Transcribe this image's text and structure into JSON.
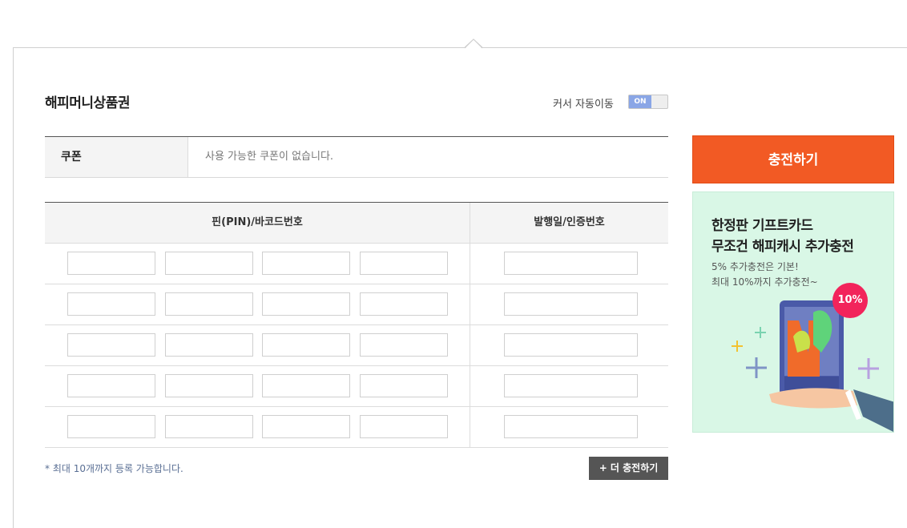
{
  "section": {
    "title": "해피머니상품권",
    "cursor_auto_move_label": "커서 자동이동",
    "toggle_state": "ON"
  },
  "coupon": {
    "label": "쿠폰",
    "value": "사용 가능한 쿠폰이 없습니다."
  },
  "table": {
    "col_pin": "핀(PIN)/바코드번호",
    "col_issue": "발행일/인증번호",
    "rows": [
      {
        "pin": [
          "",
          "",
          "",
          ""
        ],
        "issue": ""
      },
      {
        "pin": [
          "",
          "",
          "",
          ""
        ],
        "issue": ""
      },
      {
        "pin": [
          "",
          "",
          "",
          ""
        ],
        "issue": ""
      },
      {
        "pin": [
          "",
          "",
          "",
          ""
        ],
        "issue": ""
      },
      {
        "pin": [
          "",
          "",
          "",
          ""
        ],
        "issue": ""
      }
    ]
  },
  "footer": {
    "note": "* 최대 10개까지 등록 가능합니다.",
    "more_button": "+ 더 충전하기"
  },
  "sidebar": {
    "charge_button": "충전하기",
    "ad": {
      "line1": "한정판 기프트카드",
      "line2": "무조건 해피캐시 추가충전",
      "sub1": "5% 추가충전은 기본!",
      "sub2": "최대 10%까지 추가충전~",
      "badge": "10%"
    }
  },
  "colors": {
    "accent": "#f25a24",
    "toggle_on": "#8aa6e6",
    "ad_background": "#d9f7e6",
    "badge": "#f2245b"
  },
  "icons": [
    "plus-icon"
  ]
}
